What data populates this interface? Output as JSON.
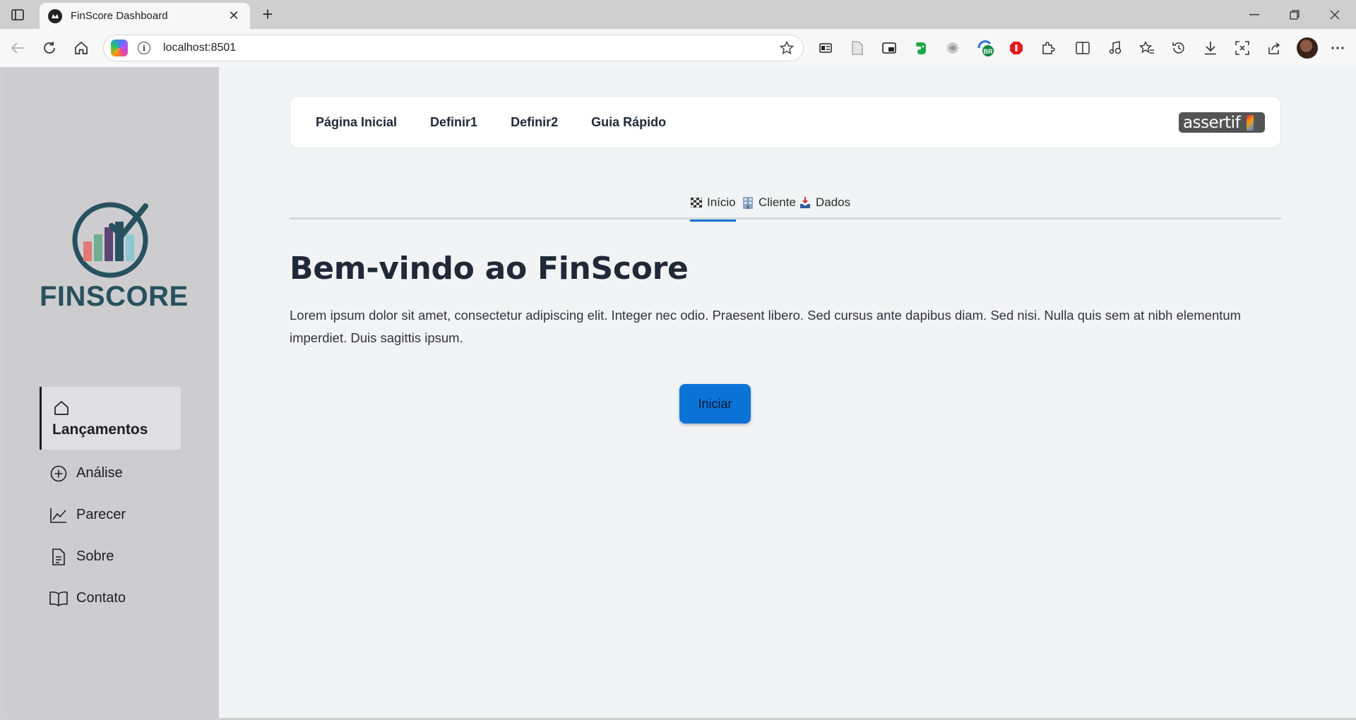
{
  "browser": {
    "tab_title": "FinScore Dashboard",
    "url": "localhost:8501",
    "extension_badge": "BR"
  },
  "sidebar": {
    "logo_text": "FINSCORE",
    "items": [
      {
        "label": "Lançamentos",
        "icon": "home-icon",
        "active": true
      },
      {
        "label": "Análise",
        "icon": "plus-circle-icon",
        "active": false
      },
      {
        "label": "Parecer",
        "icon": "line-chart-icon",
        "active": false
      },
      {
        "label": "Sobre",
        "icon": "document-icon",
        "active": false
      },
      {
        "label": "Contato",
        "icon": "book-icon",
        "active": false
      }
    ]
  },
  "topnav": {
    "links": [
      "Página Inicial",
      "Definir1",
      "Definir2",
      "Guia Rápido"
    ],
    "brand": "assertif"
  },
  "tabs": [
    {
      "label": "Início",
      "icon": "checkered-flag-icon",
      "active": true
    },
    {
      "label": "Cliente",
      "icon": "office-building-icon",
      "active": false
    },
    {
      "label": "Dados",
      "icon": "inbox-tray-icon",
      "active": false
    }
  ],
  "content": {
    "heading": "Bem-vindo ao FinScore",
    "paragraph": "Lorem ipsum dolor sit amet, consectetur adipiscing elit. Integer nec odio. Praesent libero. Sed cursus ante dapibus diam. Sed nisi. Nulla quis sem at nibh elementum imperdiet. Duis sagittis ipsum.",
    "button": "Iniciar"
  },
  "colors": {
    "accent": "#0b73d8",
    "sidebar_bg": "#cdcdcf",
    "page_bg": "#f2f3f5",
    "logo": "#27515e"
  }
}
